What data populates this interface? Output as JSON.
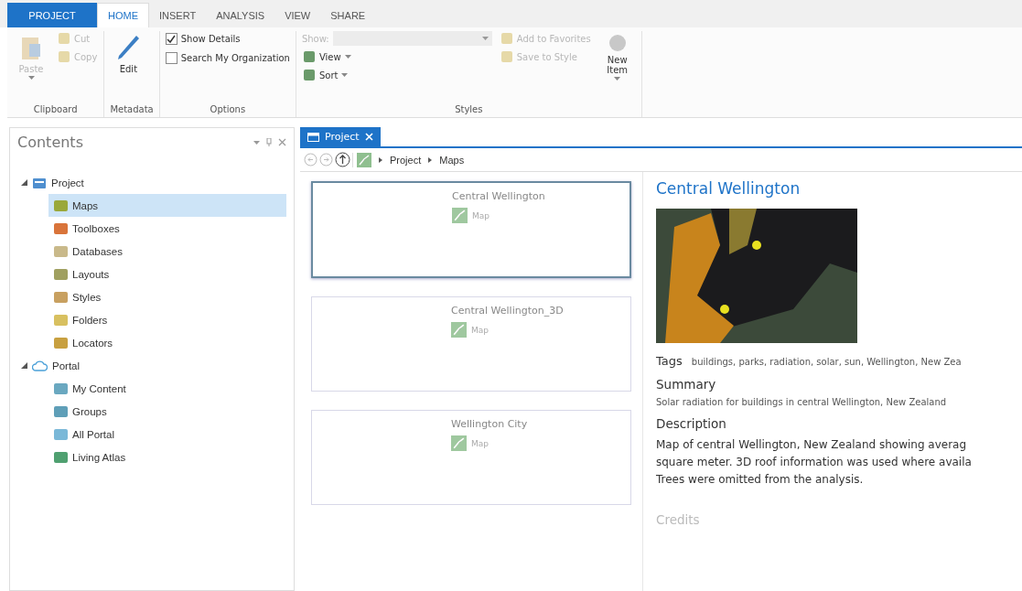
{
  "ribbon": {
    "tabs": [
      {
        "label": "PROJECT",
        "kind": "backstage",
        "selected": false
      },
      {
        "label": "HOME",
        "kind": "tab",
        "selected": true
      },
      {
        "label": "INSERT",
        "kind": "tab",
        "selected": false
      },
      {
        "label": "ANALYSIS",
        "kind": "tab",
        "selected": false
      },
      {
        "label": "VIEW",
        "kind": "tab",
        "selected": false
      },
      {
        "label": "SHARE",
        "kind": "tab",
        "selected": false
      }
    ],
    "groups": [
      {
        "label": "Clipboard",
        "columns": [
          [
            {
              "kind": "large",
              "label": "Paste",
              "disabled": true,
              "menu": true
            }
          ],
          [
            {
              "kind": "small",
              "label": "Cut",
              "disabled": true
            },
            {
              "kind": "small",
              "label": "Copy",
              "disabled": true
            }
          ]
        ]
      },
      {
        "label": "Metadata",
        "columns": [
          [
            {
              "kind": "large",
              "label": "Edit",
              "disabled": false,
              "menu": false
            }
          ]
        ]
      },
      {
        "label": "Options",
        "columns": [
          [
            {
              "kind": "checkbox",
              "label": "Show Details",
              "checked": true
            },
            {
              "kind": "checkbox",
              "label": "Search My Organization",
              "checked": false
            }
          ]
        ]
      },
      {
        "label": "Styles",
        "columns": [
          [
            {
              "kind": "dropdown",
              "label": "Show:",
              "disabled": true
            },
            {
              "kind": "small",
              "label": "View",
              "disabled": false,
              "menu": true
            },
            {
              "kind": "small",
              "label": "Sort",
              "disabled": false,
              "menu": true
            }
          ],
          [
            {
              "kind": "small",
              "label": "Add to Favorites",
              "disabled": true
            },
            {
              "kind": "small",
              "label": "Save to Style",
              "disabled": true
            }
          ],
          [
            {
              "kind": "large",
              "label": "New Item",
              "disabled": false,
              "menu": true
            }
          ]
        ]
      }
    ]
  },
  "contents": {
    "title": "Contents",
    "tree": [
      {
        "label": "Project",
        "expanded": true,
        "selected": false,
        "children": [
          {
            "label": "Maps",
            "selected": true,
            "color": "#9aa83a"
          },
          {
            "label": "Toolboxes",
            "selected": false,
            "color": "#d9743a"
          },
          {
            "label": "Databases",
            "selected": false,
            "color": "#c9b98a"
          },
          {
            "label": "Layouts",
            "selected": false,
            "color": "#a0a060"
          },
          {
            "label": "Styles",
            "selected": false,
            "color": "#c8a060"
          },
          {
            "label": "Folders",
            "selected": false,
            "color": "#d8c060"
          },
          {
            "label": "Locators",
            "selected": false,
            "color": "#c8a040"
          }
        ]
      },
      {
        "label": "Portal",
        "expanded": true,
        "selected": false,
        "children": [
          {
            "label": "My Content",
            "selected": false,
            "color": "#6aa8c0"
          },
          {
            "label": "Groups",
            "selected": false,
            "color": "#5f9fb8"
          },
          {
            "label": "All Portal",
            "selected": false,
            "color": "#7ab8d8"
          },
          {
            "label": "Living Atlas",
            "selected": false,
            "color": "#4fa070"
          }
        ]
      }
    ]
  },
  "project_view": {
    "tab": "Project",
    "breadcrumb": [
      "Project",
      "Maps"
    ],
    "items": [
      {
        "name": "Central Wellington",
        "type": "Map",
        "selected": true
      },
      {
        "name": "Central Wellington_3D",
        "type": "Map",
        "selected": false
      },
      {
        "name": "Wellington City",
        "type": "Map",
        "selected": false
      }
    ],
    "details": {
      "title": "Central Wellington",
      "tags_label": "Tags",
      "tags": "buildings, parks, radiation, solar, sun, Wellington, New Zea",
      "summary_label": "Summary",
      "summary": "Solar radiation for buildings in central Wellington, New Zealand",
      "description_label": "Description",
      "description": [
        "Map of central Wellington, New Zealand showing averag",
        "square meter. 3D roof information was used where availa",
        "Trees were omitted from the analysis."
      ],
      "credits_label": "Credits"
    }
  }
}
